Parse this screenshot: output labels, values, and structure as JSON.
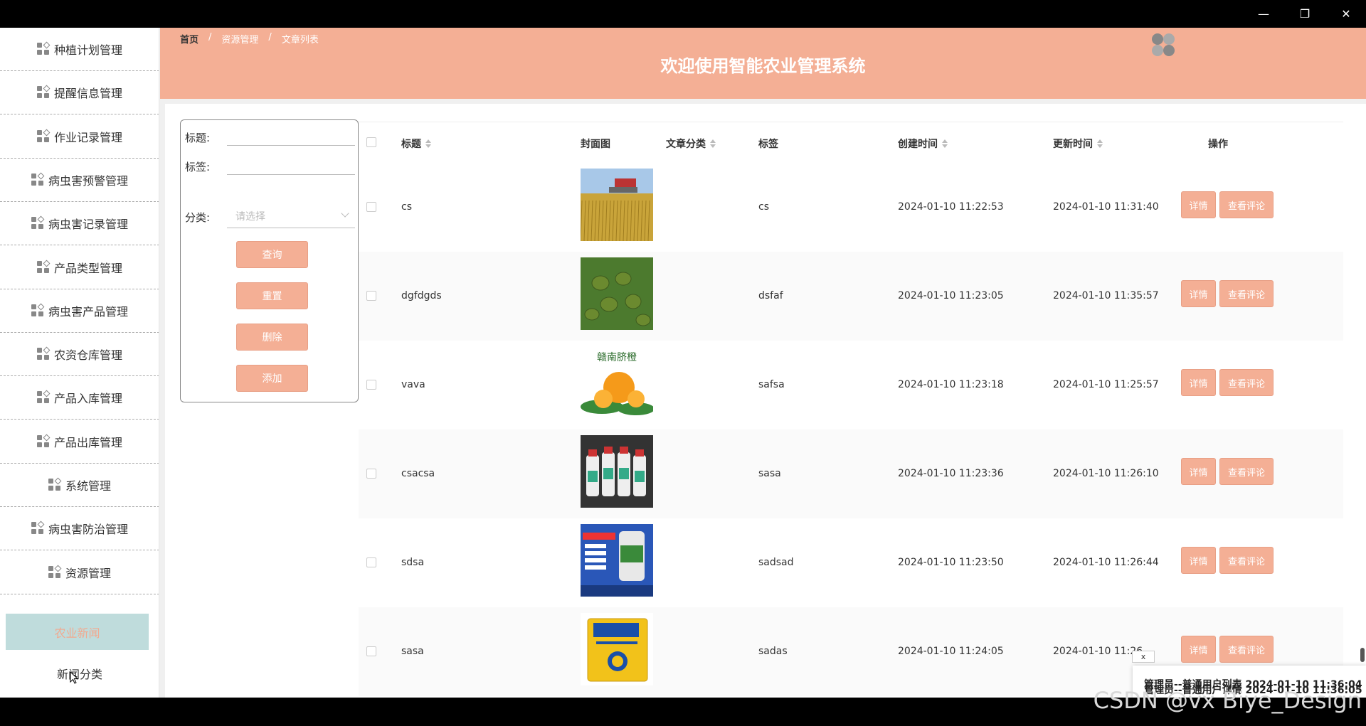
{
  "window": {
    "minimize": "—",
    "restore": "❐",
    "close": "✕"
  },
  "sidebar": {
    "items": [
      {
        "label": "种植计划管理"
      },
      {
        "label": "提醒信息管理"
      },
      {
        "label": "作业记录管理"
      },
      {
        "label": "病虫害预警管理"
      },
      {
        "label": "病虫害记录管理"
      },
      {
        "label": "产品类型管理"
      },
      {
        "label": "病虫害产品管理"
      },
      {
        "label": "农资仓库管理"
      },
      {
        "label": "产品入库管理"
      },
      {
        "label": "产品出库管理"
      },
      {
        "label": "系统管理"
      },
      {
        "label": "病虫害防治管理"
      },
      {
        "label": "资源管理"
      }
    ],
    "sub_active": "农业新闻",
    "sub_next": "新闻分类"
  },
  "header": {
    "breadcrumb": [
      "首页",
      "资源管理",
      "文章列表"
    ],
    "title": "欢迎使用智能农业管理系统"
  },
  "search": {
    "title_label": "标题:",
    "tag_label": "标签:",
    "category_label": "分类:",
    "category_placeholder": "请选择",
    "query": "查询",
    "reset": "重置",
    "delete": "删除",
    "add": "添加"
  },
  "table": {
    "headers": {
      "title": "标题",
      "cover": "封面图",
      "category": "文章分类",
      "tag": "标签",
      "created": "创建时间",
      "updated": "更新时间",
      "actions": "操作"
    },
    "detail_label": "详情",
    "comment_label": "查看评论",
    "rows": [
      {
        "title": "cs",
        "tag": "cs",
        "created": "2024-01-10 11:22:53",
        "updated": "2024-01-10 11:31:40",
        "cover": "wheat-field"
      },
      {
        "title": "dgfdgds",
        "tag": "dsfaf",
        "created": "2024-01-10 11:23:05",
        "updated": "2024-01-10 11:35:57",
        "cover": "kiwi-fruit"
      },
      {
        "title": "vava",
        "tag": "safsa",
        "created": "2024-01-10 11:23:18",
        "updated": "2024-01-10 11:25:57",
        "cover": "orange"
      },
      {
        "title": "csacsa",
        "tag": "sasa",
        "created": "2024-01-10 11:23:36",
        "updated": "2024-01-10 11:26:10",
        "cover": "pesticide-bottles"
      },
      {
        "title": "sdsa",
        "tag": "sadsad",
        "created": "2024-01-10 11:23:50",
        "updated": "2024-01-10 11:26:44",
        "cover": "pesticide-poster"
      },
      {
        "title": "sasa",
        "tag": "sadas",
        "created": "2024-01-10 11:24:05",
        "updated": "2024-01-10 11:26",
        "cover": "fertilizer-bag"
      }
    ]
  },
  "notification": {
    "close": "x",
    "line1": "管理员--普通用户列表 2024-01-10 11:36:04",
    "line2": "管理员--普通用户详情 2024-01-10 11:36:05"
  },
  "watermark": "CSDN @vx Biye_Design",
  "colors": {
    "accent": "#f4af95",
    "sub_active_bg": "#bfdcdc"
  }
}
